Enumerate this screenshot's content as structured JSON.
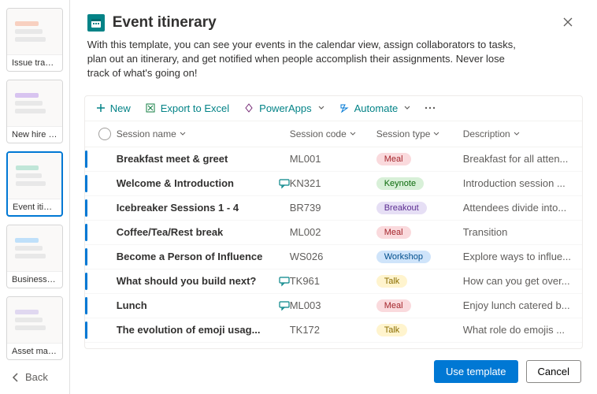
{
  "sidebar": {
    "back_label": "Back",
    "templates": [
      {
        "label": "Issue tracker",
        "selected": false
      },
      {
        "label": "New hire checkli...",
        "selected": false
      },
      {
        "label": "Event itinerary",
        "selected": true
      },
      {
        "label": "Business trip ap...",
        "selected": false
      },
      {
        "label": "Asset manager",
        "selected": false
      }
    ]
  },
  "header": {
    "title": "Event itinerary",
    "description": "With this template, you can see your events in the calendar view, assign collaborators to tasks, plan out an itinerary, and get notified when people accomplish their assignments. Never lose track of what's going on!"
  },
  "toolbar": {
    "new_label": "New",
    "export_label": "Export to Excel",
    "powerapps_label": "PowerApps",
    "automate_label": "Automate"
  },
  "columns": {
    "name": "Session name",
    "code": "Session code",
    "type": "Session type",
    "desc": "Description"
  },
  "rows": [
    {
      "name": "Breakfast meet & greet",
      "code": "ML001",
      "type": "Meal",
      "desc": "Breakfast for all atten...",
      "comment": false
    },
    {
      "name": "Welcome & Introduction",
      "code": "KN321",
      "type": "Keynote",
      "desc": "Introduction session ...",
      "comment": true
    },
    {
      "name": "Icebreaker Sessions 1 - 4",
      "code": "BR739",
      "type": "Breakout",
      "desc": "Attendees divide into...",
      "comment": false
    },
    {
      "name": "Coffee/Tea/Rest break",
      "code": "ML002",
      "type": "Meal",
      "desc": "Transition",
      "comment": false
    },
    {
      "name": "Become a Person of Influence",
      "code": "WS026",
      "type": "Workshop",
      "desc": "Explore ways to influe...",
      "comment": false
    },
    {
      "name": "What should you build next?",
      "code": "TK961",
      "type": "Talk",
      "desc": "How can you get over...",
      "comment": true
    },
    {
      "name": "Lunch",
      "code": "ML003",
      "type": "Meal",
      "desc": "Enjoy lunch catered b...",
      "comment": true
    },
    {
      "name": "The evolution of emoji usag...",
      "code": "TK172",
      "type": "Talk",
      "desc": "What role do emojis ...",
      "comment": false
    }
  ],
  "footer": {
    "use_label": "Use template",
    "cancel_label": "Cancel"
  }
}
